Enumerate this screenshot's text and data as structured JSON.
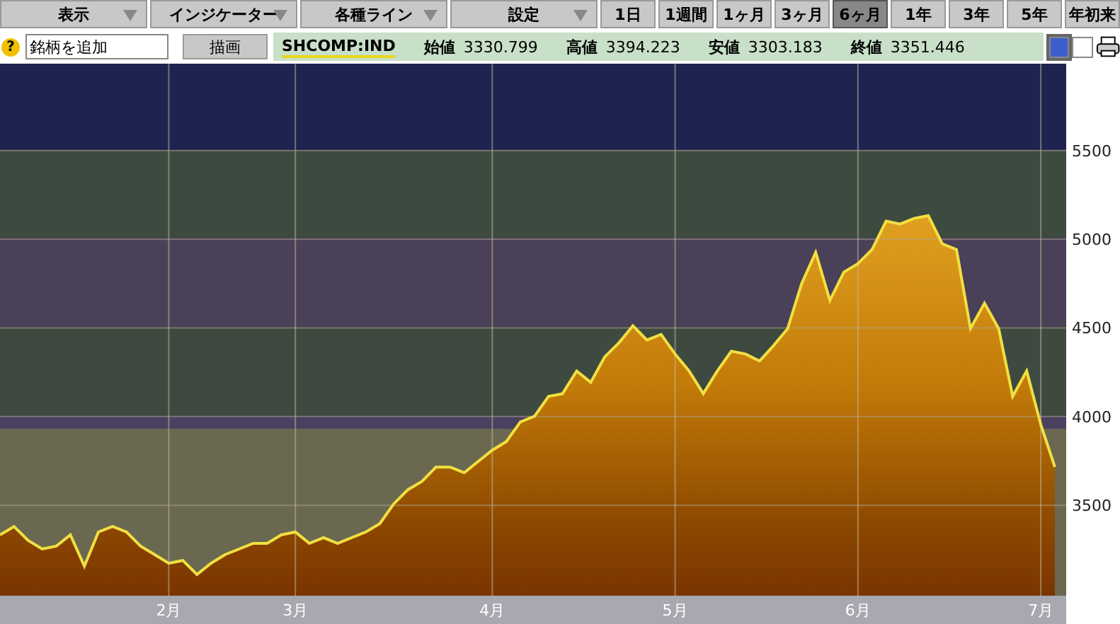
{
  "menus": [
    {
      "label": "表示"
    },
    {
      "label": "インジケーター"
    },
    {
      "label": "各種ライン"
    },
    {
      "label": "設定"
    }
  ],
  "periods": [
    {
      "label": "1日",
      "selected": false
    },
    {
      "label": "1週間",
      "selected": false
    },
    {
      "label": "1ヶ月",
      "selected": false
    },
    {
      "label": "3ヶ月",
      "selected": false
    },
    {
      "label": "6ヶ月",
      "selected": true
    },
    {
      "label": "1年",
      "selected": false
    },
    {
      "label": "3年",
      "selected": false
    },
    {
      "label": "5年",
      "selected": false
    },
    {
      "label": "年初来",
      "selected": false
    }
  ],
  "help": "?",
  "symbol_field": {
    "value": "銘柄を追加"
  },
  "draw_button": "描画",
  "quote": {
    "symbol": "SHCOMP:IND",
    "fields": [
      {
        "label": "始値",
        "value": "3330.799"
      },
      {
        "label": "高値",
        "value": "3394.223"
      },
      {
        "label": "安値",
        "value": "3303.183"
      },
      {
        "label": "終値",
        "value": "3351.446"
      }
    ]
  },
  "themes": [
    {
      "color": "#3a5fcd",
      "selected": true
    },
    {
      "color": "#ffffff",
      "selected": false
    }
  ],
  "chart": {
    "chart_data": {
      "type": "area",
      "grid": true,
      "ylim": [
        2990,
        5990
      ],
      "yticks": [
        3500,
        4000,
        4500,
        5000,
        5500
      ],
      "categories": [
        null,
        null,
        null,
        null,
        null,
        null,
        null,
        null,
        null,
        null,
        null,
        null,
        "2月",
        null,
        null,
        null,
        null,
        null,
        null,
        null,
        null,
        "3月",
        null,
        null,
        null,
        null,
        null,
        null,
        null,
        null,
        null,
        null,
        null,
        null,
        null,
        "4月",
        null,
        null,
        null,
        null,
        null,
        null,
        null,
        null,
        null,
        null,
        null,
        null,
        "5月",
        null,
        null,
        null,
        null,
        null,
        null,
        null,
        null,
        null,
        null,
        null,
        null,
        "6月",
        null,
        null,
        null,
        null,
        null,
        null,
        null,
        null,
        null,
        null,
        null,
        null,
        "7月",
        null
      ],
      "series": [
        {
          "color": "#f0e040",
          "values": [
            3333,
            3380,
            3301,
            3253,
            3269,
            3333,
            3157,
            3349,
            3380,
            3349,
            3269,
            3221,
            3173,
            3189,
            3110,
            3173,
            3221,
            3253,
            3285,
            3285,
            3333,
            3349,
            3285,
            3317,
            3285,
            3317,
            3349,
            3396,
            3508,
            3588,
            3635,
            3715,
            3715,
            3683,
            3747,
            3811,
            3859,
            3970,
            4002,
            4114,
            4129,
            4257,
            4193,
            4337,
            4416,
            4512,
            4432,
            4464,
            4353,
            4257,
            4129,
            4257,
            4369,
            4353,
            4313,
            4400,
            4496,
            4751,
            4926,
            4655,
            4815,
            4863,
            4942,
            5102,
            5086,
            5118,
            5133,
            4974,
            4942,
            4496,
            4639,
            4496,
            4114,
            4257,
            3954,
            3715
          ]
        }
      ]
    }
  }
}
